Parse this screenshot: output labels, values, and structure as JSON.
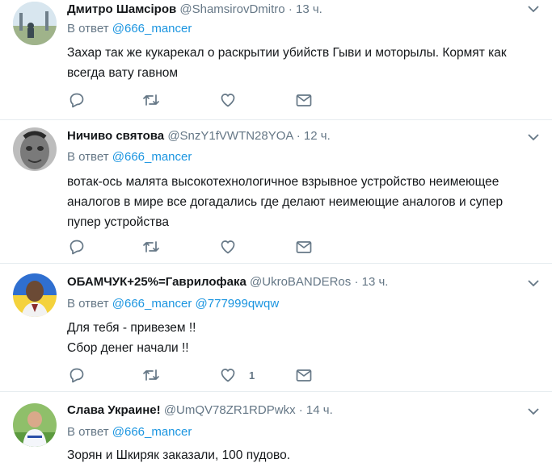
{
  "reply_prefix": "В ответ",
  "colors": {
    "accent": "#1b95e0",
    "secondary": "#657786",
    "text": "#14171a",
    "divider": "#e6ecf0"
  },
  "tweets": [
    {
      "name": "Дмитро Шамсіров",
      "handle": "@ShamsirovDmitro",
      "time": "· 13 ч.",
      "mentions": [
        "@666_mancer"
      ],
      "text": [
        "Захар так же кукарекал о раскрытии убийств Гыви и моторылы. Кормят как",
        "всегда вату гавном"
      ],
      "likes": ""
    },
    {
      "name": "Ничиво святова",
      "handle": "@SnzY1fVWTN28YOA",
      "time": "· 12 ч.",
      "mentions": [
        "@666_mancer"
      ],
      "text": [
        "вотак-ось малята высокотехнологичное взрывное устройство неимеющее",
        "аналогов в мире все догадались где делают неимеющие аналогов и супер",
        "пупер устройства"
      ],
      "likes": ""
    },
    {
      "name": "ОБАМЧУК+25%=Гаврилофака",
      "handle": "@UkroBANDERos",
      "time": "· 13 ч.",
      "mentions": [
        "@666_mancer",
        "@777999qwqw"
      ],
      "text": [
        "Для тебя - привезем !!",
        "Сбор денег начали !!"
      ],
      "likes": "1"
    },
    {
      "name": "Слава Украине!",
      "handle": "@UmQV78ZR1RDPwkx",
      "time": "· 14 ч.",
      "mentions": [
        "@666_mancer"
      ],
      "text": [
        "Зорян и Шкиряк заказали, 100 пудово."
      ],
      "likes": ""
    }
  ]
}
